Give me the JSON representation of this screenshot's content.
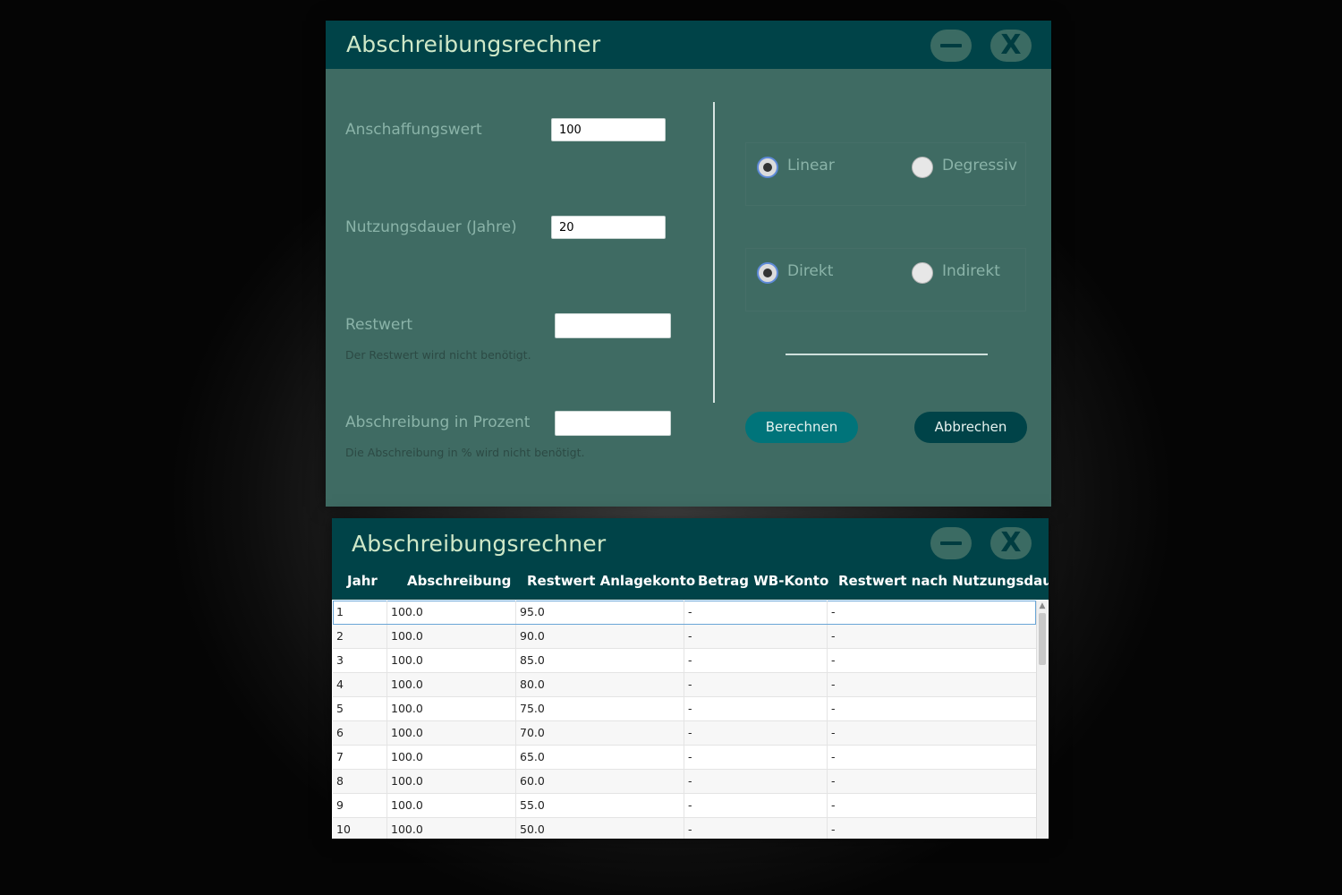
{
  "window1": {
    "title": "Abschreibungsrechner",
    "fields": {
      "anschaffungswert_label": "Anschaffungswert",
      "anschaffungswert_value": "100",
      "nutzungsdauer_label": "Nutzungsdauer (Jahre)",
      "nutzungsdauer_value": "20",
      "restwert_label": "Restwert",
      "restwert_value": "",
      "restwert_hint": "Der Restwert wird nicht benötigt.",
      "prozent_label": "Abschreibung in Prozent",
      "prozent_value": "",
      "prozent_hint": "Die Abschreibung in % wird nicht benötigt."
    },
    "method": {
      "linear": "Linear",
      "degressiv": "Degressiv",
      "selected": "Linear"
    },
    "booking": {
      "direkt": "Direkt",
      "indirekt": "Indirekt",
      "selected": "Direkt"
    },
    "buttons": {
      "calculate": "Berechnen",
      "cancel": "Abbrechen"
    }
  },
  "window2": {
    "title": "Abschreibungsrechner",
    "columns": [
      "Jahr",
      "Abschreibung",
      "Restwert Anlagekonto",
      "Betrag WB-Konto",
      "Restwert nach Nutzungsdauer"
    ],
    "rows": [
      [
        "1",
        "100.0",
        "95.0",
        "-",
        "-"
      ],
      [
        "2",
        "100.0",
        "90.0",
        "-",
        "-"
      ],
      [
        "3",
        "100.0",
        "85.0",
        "-",
        "-"
      ],
      [
        "4",
        "100.0",
        "80.0",
        "-",
        "-"
      ],
      [
        "5",
        "100.0",
        "75.0",
        "-",
        "-"
      ],
      [
        "6",
        "100.0",
        "70.0",
        "-",
        "-"
      ],
      [
        "7",
        "100.0",
        "65.0",
        "-",
        "-"
      ],
      [
        "8",
        "100.0",
        "60.0",
        "-",
        "-"
      ],
      [
        "9",
        "100.0",
        "55.0",
        "-",
        "-"
      ],
      [
        "10",
        "100.0",
        "50.0",
        "-",
        "-"
      ]
    ]
  },
  "icons": {
    "minimize": "minimize-icon",
    "close": "close-icon"
  },
  "colors": {
    "titlebar": "#004348",
    "panel": "#3f6b63",
    "accent": "#00747a"
  }
}
